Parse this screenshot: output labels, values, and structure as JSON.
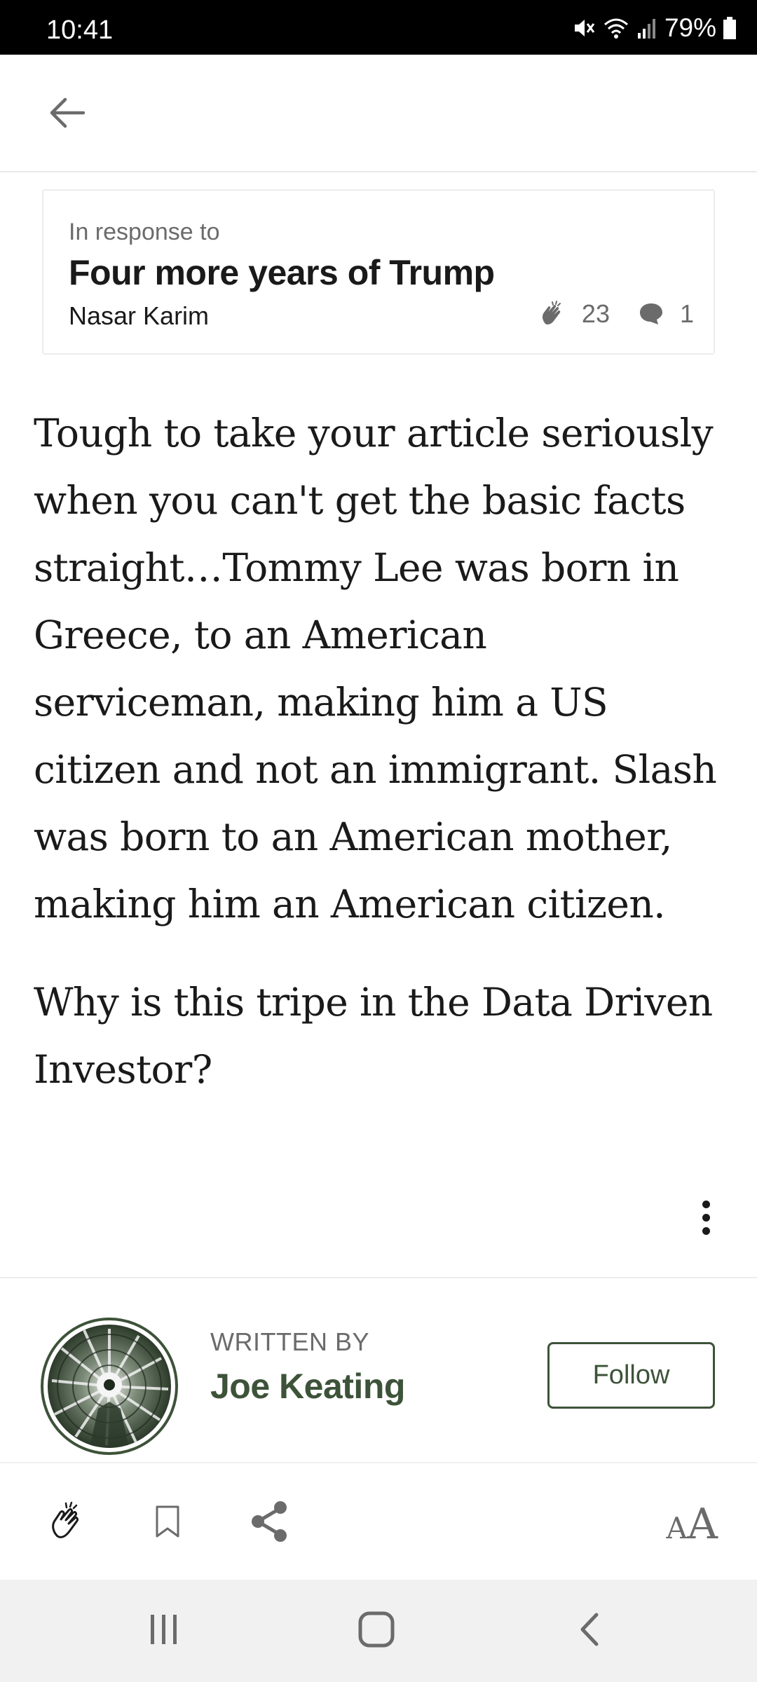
{
  "status_bar": {
    "time": "10:41",
    "battery": "79%"
  },
  "response_card": {
    "label": "In response to",
    "title": "Four more years of Trump",
    "author": "Nasar Karim",
    "claps": "23",
    "comments": "1"
  },
  "article": {
    "paragraphs": [
      "Tough to take your article seriously when you can't get the basic facts straight…Tommy Lee was born in Greece, to an American serviceman, making him a US citizen and not an immigrant. Slash was born to an American mother, making him an American citizen.",
      "Why is this tripe in the Data Driven Investor?"
    ]
  },
  "author_section": {
    "written_by": "WRITTEN BY",
    "name": "Joe Keating",
    "follow_label": "Follow"
  },
  "text_size": {
    "small": "A",
    "large": "A"
  },
  "icons": {
    "back": "arrow-left-icon",
    "clap": "clap-icon",
    "comment": "comment-icon",
    "more": "more-vertical-icon",
    "bookmark": "bookmark-icon",
    "share": "share-icon",
    "recents": "recents-icon",
    "home": "home-icon",
    "nav_back": "nav-back-icon"
  },
  "colors": {
    "accent": "#3d5339",
    "muted_text": "#6b6b6b",
    "text": "#1a1a1a"
  }
}
